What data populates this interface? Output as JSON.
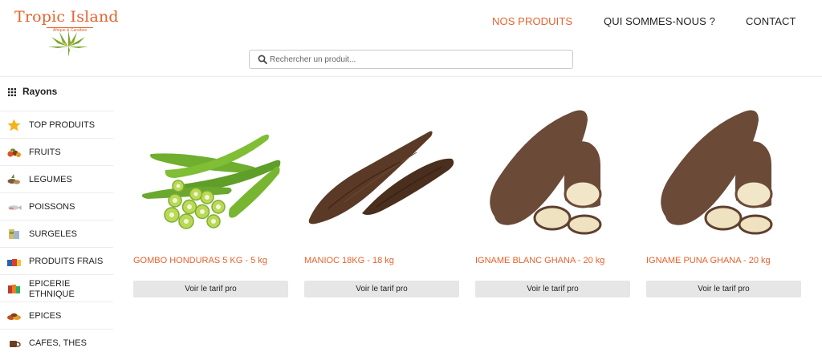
{
  "logo": {
    "title": "Tropic Island",
    "subtitle": "Afrique & Caraïbes"
  },
  "nav": [
    {
      "label": "NOS PRODUITS",
      "active": true
    },
    {
      "label": "QUI SOMMES-NOUS ?"
    },
    {
      "label": "CONTACT"
    }
  ],
  "search": {
    "placeholder": "Rechercher un produit...",
    "value": "",
    "icon": "search-icon"
  },
  "sidebar": {
    "title": "Rayons",
    "title_icon": "grid-icon",
    "items": [
      {
        "label": "TOP PRODUITS",
        "icon": "star-icon"
      },
      {
        "label": "FRUITS",
        "icon": "fruits-icon"
      },
      {
        "label": "LEGUMES",
        "icon": "vegetables-icon"
      },
      {
        "label": "POISSONS",
        "icon": "fish-icon"
      },
      {
        "label": "SURGELES",
        "icon": "frozen-icon"
      },
      {
        "label": "PRODUITS FRAIS",
        "icon": "fresh-products-icon"
      },
      {
        "label": "EPICERIE ETHNIQUE",
        "icon": "grocery-icon"
      },
      {
        "label": "EPICES",
        "icon": "spices-icon"
      },
      {
        "label": "CAFES, THES",
        "icon": "coffee-icon"
      }
    ]
  },
  "products": [
    {
      "name": "GOMBO HONDURAS 5 KG - 5 kg",
      "button": "Voir le tarif pro",
      "image": "okra"
    },
    {
      "name": "MANIOC 18KG - 18 kg",
      "button": "Voir le tarif pro",
      "image": "cassava"
    },
    {
      "name": "IGNAME BLANC GHANA - 20 kg",
      "button": "Voir le tarif pro",
      "image": "yam"
    },
    {
      "name": "IGNAME PUNA GHANA - 20 kg",
      "button": "Voir le tarif pro",
      "image": "yam"
    }
  ],
  "colors": {
    "accent": "#e8612c",
    "button_bg": "#e6e6e6",
    "border": "#ececec"
  }
}
